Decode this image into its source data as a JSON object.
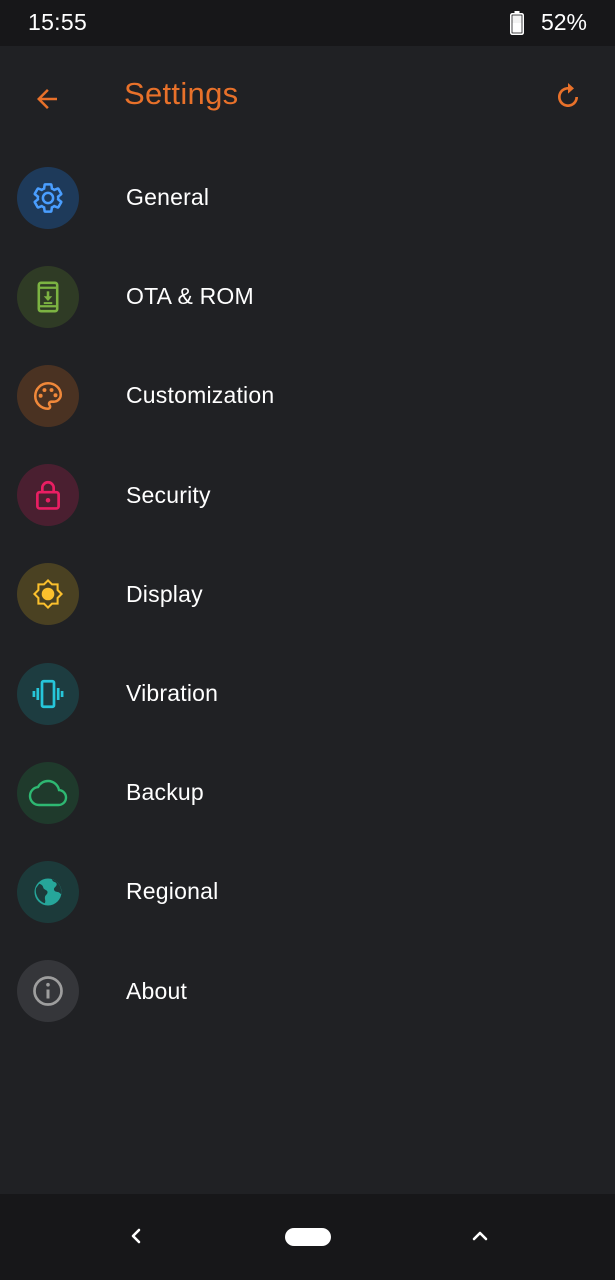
{
  "status_bar": {
    "time": "15:55",
    "battery_percent": "52%",
    "battery_icon": "battery-icon"
  },
  "app_bar": {
    "title": "Settings",
    "back_icon": "arrow-back-icon",
    "reset_icon": "restore-icon",
    "accent_color": "#e8712a"
  },
  "settings_items": [
    {
      "label": "General",
      "icon": "gear-icon",
      "color": "#4a9eff",
      "bg": "#1e3a5a"
    },
    {
      "label": "OTA & ROM",
      "icon": "system-update-icon",
      "color": "#7cb342",
      "bg": "#2f3b25"
    },
    {
      "label": "Customization",
      "icon": "palette-icon",
      "color": "#f0883a",
      "bg": "#4a3222"
    },
    {
      "label": "Security",
      "icon": "lock-icon",
      "color": "#e91e63",
      "bg": "#4a1f30"
    },
    {
      "label": "Display",
      "icon": "brightness-icon",
      "color": "#fbc02d",
      "bg": "#4a4122"
    },
    {
      "label": "Vibration",
      "icon": "vibration-icon",
      "color": "#26c6da",
      "bg": "#1d3c40"
    },
    {
      "label": "Backup",
      "icon": "cloud-icon",
      "color": "#2eb872",
      "bg": "#1f3a2c"
    },
    {
      "label": "Regional",
      "icon": "globe-icon",
      "color": "#26a69a",
      "bg": "#1c3a3a"
    },
    {
      "label": "About",
      "icon": "info-icon",
      "color": "#9e9e9e",
      "bg": "#35363a"
    }
  ],
  "nav_bar": {
    "back_icon": "nav-back-icon",
    "home_icon": "home-pill-icon",
    "recents_icon": "chevron-up-icon"
  }
}
